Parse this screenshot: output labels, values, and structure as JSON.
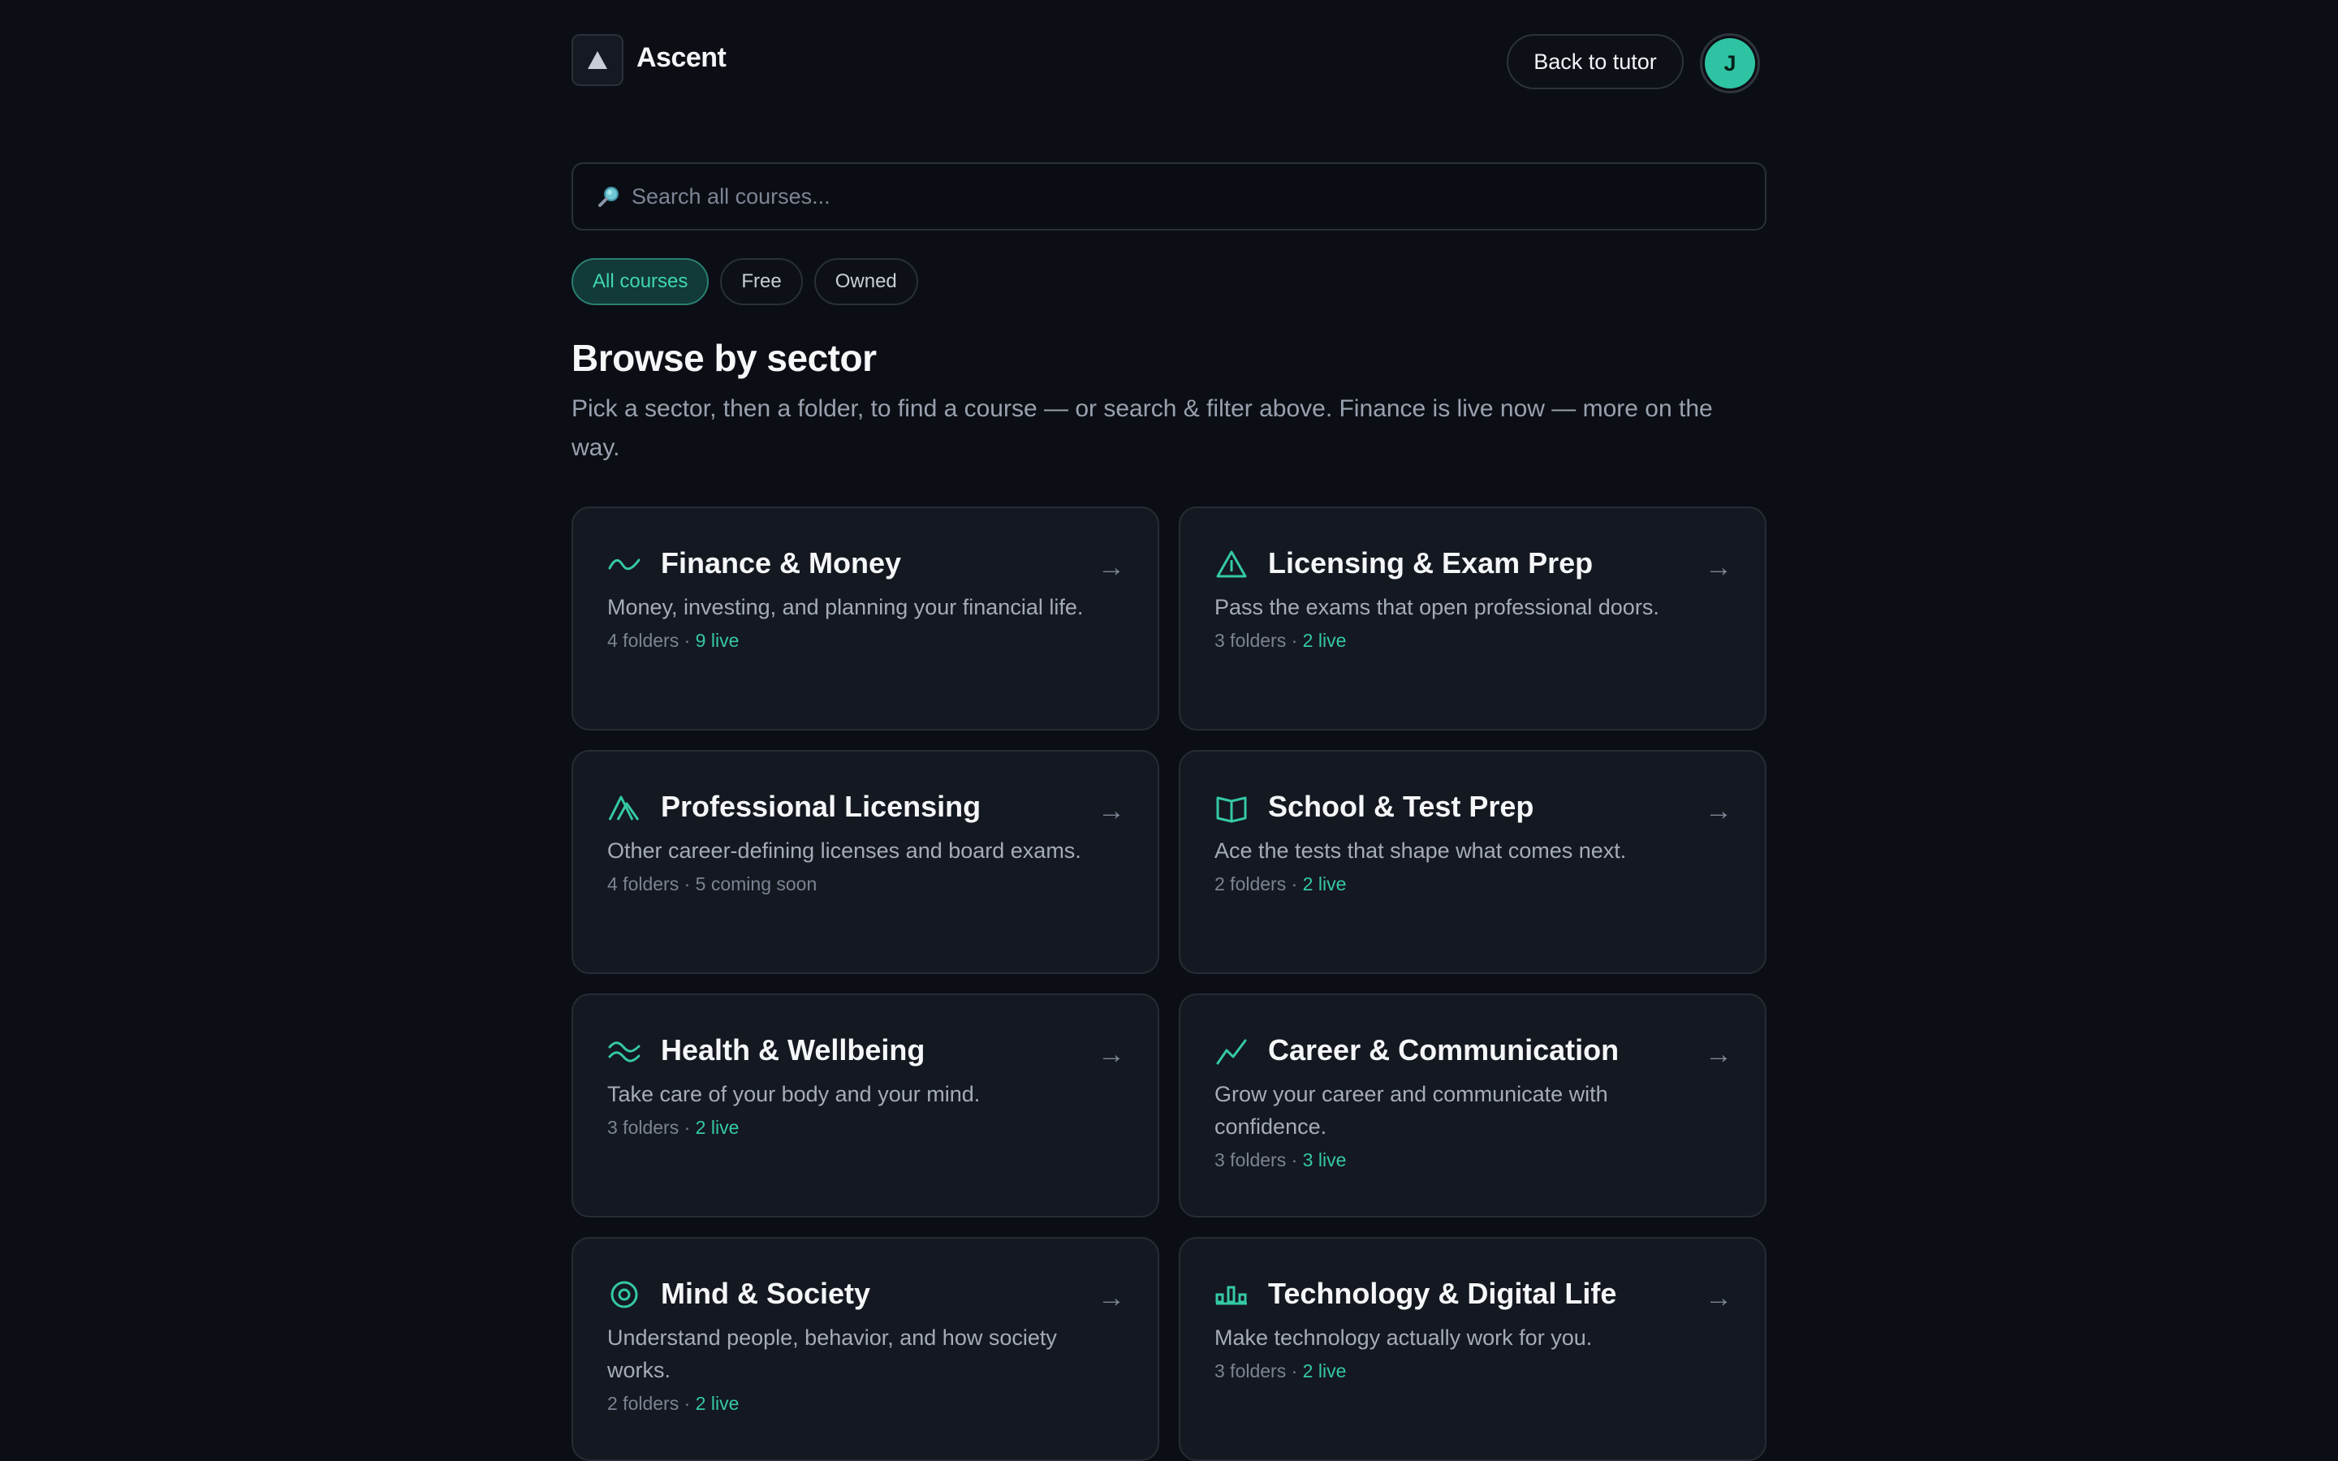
{
  "app": {
    "name": "Ascent"
  },
  "header": {
    "back_label": "Back to tutor",
    "avatar_initial": "J"
  },
  "search": {
    "placeholder": "Search all courses..."
  },
  "filters": [
    {
      "label": "All courses",
      "active": true
    },
    {
      "label": "Free",
      "active": false
    },
    {
      "label": "Owned",
      "active": false
    }
  ],
  "browse": {
    "title": "Browse by sector",
    "subtitle": "Pick a sector, then a folder, to find a course — or search & filter above. Finance is live now — more on the way."
  },
  "colors": {
    "accent": "#35c9a6",
    "background": "#0b0e14",
    "card": "#141820"
  },
  "sectors": [
    {
      "icon": "trend-wave-icon",
      "title": "Finance & Money",
      "desc": "Money, investing, and planning your financial life.",
      "folders": "4 folders",
      "sep": " · ",
      "status": "9 live",
      "live": true,
      "arrow": "→"
    },
    {
      "icon": "triangle-warning-icon",
      "title": "Licensing & Exam Prep",
      "desc": "Pass the exams that open professional doors.",
      "folders": "3 folders",
      "sep": " · ",
      "status": "2 live",
      "live": true,
      "arrow": "→"
    },
    {
      "icon": "double-peak-icon",
      "title": "Professional Licensing",
      "desc": "Other career-defining licenses and board exams.",
      "folders": "4 folders",
      "sep": " · ",
      "status": "5 coming soon",
      "live": false,
      "arrow": "→"
    },
    {
      "icon": "open-book-icon",
      "title": "School & Test Prep",
      "desc": "Ace the tests that shape what comes next.",
      "folders": "2 folders",
      "sep": " · ",
      "status": "2 live",
      "live": true,
      "arrow": "→"
    },
    {
      "icon": "waves-icon",
      "title": "Health & Wellbeing",
      "desc": "Take care of your body and your mind.",
      "folders": "3 folders",
      "sep": " · ",
      "status": "2 live",
      "live": true,
      "arrow": "→"
    },
    {
      "icon": "chart-line-icon",
      "title": "Career & Communication",
      "desc": "Grow your career and communicate with confidence.",
      "folders": "3 folders",
      "sep": " · ",
      "status": "3 live",
      "live": true,
      "arrow": "→"
    },
    {
      "icon": "target-circle-icon",
      "title": "Mind & Society",
      "desc": "Understand people, behavior, and how society works.",
      "folders": "2 folders",
      "sep": " · ",
      "status": "2 live",
      "live": true,
      "arrow": "→"
    },
    {
      "icon": "circuit-icon",
      "title": "Technology & Digital Life",
      "desc": "Make technology actually work for you.",
      "folders": "3 folders",
      "sep": " · ",
      "status": "2 live",
      "live": true,
      "arrow": "→"
    }
  ]
}
